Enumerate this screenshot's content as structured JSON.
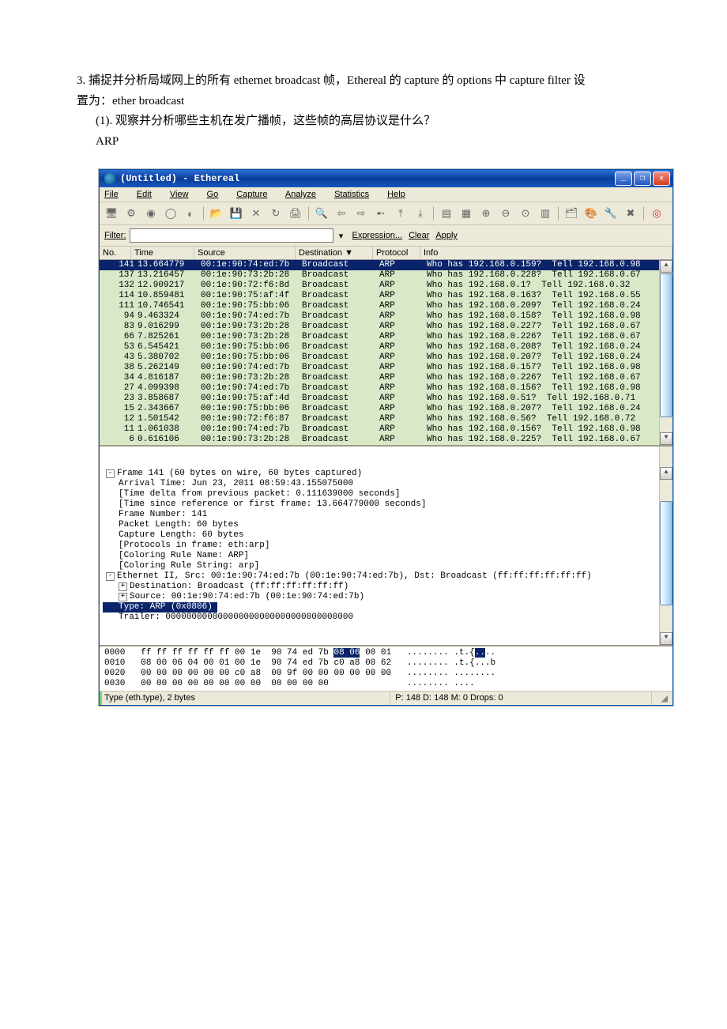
{
  "question": {
    "line1": "3. 捕捉并分析局域网上的所有 ethernet broadcast 帧，Ethereal 的 capture  的 options 中 capture filter 设",
    "line2": "置为：ether broadcast",
    "sub": "(1). 观察并分析哪些主机在发广播帧，这些帧的高层协议是什么？",
    "ans": "ARP"
  },
  "window": {
    "title": "(Untitled) - Ethereal"
  },
  "menu": {
    "file": "File",
    "edit": "Edit",
    "view": "View",
    "go": "Go",
    "capture": "Capture",
    "analyze": "Analyze",
    "statistics": "Statistics",
    "help": "Help"
  },
  "filter": {
    "label": "Filter:",
    "value": "",
    "expr": "Expression...",
    "clear": "Clear",
    "apply": "Apply",
    "dd": "▾"
  },
  "columns": {
    "no": "No. ",
    "time": "Time",
    "src": "Source",
    "dst": "Destination ▼",
    "proto": "Protocol",
    "info": "Info"
  },
  "packets": [
    {
      "no": "141",
      "time": "13.664779",
      "src": "00:1e:90:74:ed:7b",
      "dst": "Broadcast",
      "proto": "ARP",
      "info": "Who has 192.168.0.159?  Tell 192.168.0.98",
      "sel": true
    },
    {
      "no": "137",
      "time": "13.216457",
      "src": "00:1e:90:73:2b:28",
      "dst": "Broadcast",
      "proto": "ARP",
      "info": "Who has 192.168.0.228?  Tell 192.168.0.67"
    },
    {
      "no": "132",
      "time": "12.909217",
      "src": "00:1e:90:72:f6:8d",
      "dst": "Broadcast",
      "proto": "ARP",
      "info": "Who has 192.168.0.1?  Tell 192.168.0.32"
    },
    {
      "no": "114",
      "time": "10.859481",
      "src": "00:1e:90:75:af:4f",
      "dst": "Broadcast",
      "proto": "ARP",
      "info": "Who has 192.168.0.163?  Tell 192.168.0.55"
    },
    {
      "no": "111",
      "time": "10.746541",
      "src": "00:1e:90:75:bb:06",
      "dst": "Broadcast",
      "proto": "ARP",
      "info": "Who has 192.168.0.209?  Tell 192.168.0.24"
    },
    {
      "no": "94",
      "time": "9.463324",
      "src": "00:1e:90:74:ed:7b",
      "dst": "Broadcast",
      "proto": "ARP",
      "info": "Who has 192.168.0.158?  Tell 192.168.0.98"
    },
    {
      "no": "83",
      "time": "9.016299",
      "src": "00:1e:90:73:2b:28",
      "dst": "Broadcast",
      "proto": "ARP",
      "info": "Who has 192.168.0.227?  Tell 192.168.0.67"
    },
    {
      "no": "66",
      "time": "7.825261",
      "src": "00:1e:90:73:2b:28",
      "dst": "Broadcast",
      "proto": "ARP",
      "info": "Who has 192.168.0.226?  Tell 192.168.0.67"
    },
    {
      "no": "53",
      "time": "6.545421",
      "src": "00:1e:90:75:bb:06",
      "dst": "Broadcast",
      "proto": "ARP",
      "info": "Who has 192.168.0.208?  Tell 192.168.0.24"
    },
    {
      "no": "43",
      "time": "5.380702",
      "src": "00:1e:90:75:bb:06",
      "dst": "Broadcast",
      "proto": "ARP",
      "info": "Who has 192.168.0.207?  Tell 192.168.0.24"
    },
    {
      "no": "38",
      "time": "5.262149",
      "src": "00:1e:90:74:ed:7b",
      "dst": "Broadcast",
      "proto": "ARP",
      "info": "Who has 192.168.0.157?  Tell 192.168.0.98"
    },
    {
      "no": "34",
      "time": "4.816187",
      "src": "00:1e:90:73:2b:28",
      "dst": "Broadcast",
      "proto": "ARP",
      "info": "Who has 192.168.0.226?  Tell 192.168.0.67"
    },
    {
      "no": "27",
      "time": "4.099398",
      "src": "00:1e:90:74:ed:7b",
      "dst": "Broadcast",
      "proto": "ARP",
      "info": "Who has 192.168.0.156?  Tell 192.168.0.98"
    },
    {
      "no": "23",
      "time": "3.858687",
      "src": "00:1e:90:75:af:4d",
      "dst": "Broadcast",
      "proto": "ARP",
      "info": "Who has 192.168.0.51?  Tell 192.168.0.71"
    },
    {
      "no": "15",
      "time": "2.343667",
      "src": "00:1e:90:75:bb:06",
      "dst": "Broadcast",
      "proto": "ARP",
      "info": "Who has 192.168.0.207?  Tell 192.168.0.24"
    },
    {
      "no": "12",
      "time": "1.501542",
      "src": "00:1e:90:72:f6:87",
      "dst": "Broadcast",
      "proto": "ARP",
      "info": "Who has 192.168.0.56?  Tell 192.168.0.72"
    },
    {
      "no": "11",
      "time": "1.061038",
      "src": "00:1e:90:74:ed:7b",
      "dst": "Broadcast",
      "proto": "ARP",
      "info": "Who has 192.168.0.156?  Tell 192.168.0.98"
    },
    {
      "no": "6",
      "time": "0.616106",
      "src": "00:1e:90:73:2b:28",
      "dst": "Broadcast",
      "proto": "ARP",
      "info": "Who has 192.168.0.225?  Tell 192.168.0.67"
    }
  ],
  "tree": [
    {
      "lvl": 0,
      "sym": "⊟",
      "txt": "Frame 141 (60 bytes on wire, 60 bytes captured)"
    },
    {
      "lvl": 1,
      "txt": "Arrival Time: Jun 23, 2011 08:59:43.155075000"
    },
    {
      "lvl": 1,
      "txt": "[Time delta from previous packet: 0.111639000 seconds]"
    },
    {
      "lvl": 1,
      "txt": "[Time since reference or first frame: 13.664779000 seconds]"
    },
    {
      "lvl": 1,
      "txt": "Frame Number: 141"
    },
    {
      "lvl": 1,
      "txt": "Packet Length: 60 bytes"
    },
    {
      "lvl": 1,
      "txt": "Capture Length: 60 bytes"
    },
    {
      "lvl": 1,
      "txt": "[Protocols in frame: eth:arp]"
    },
    {
      "lvl": 1,
      "txt": "[Coloring Rule Name: ARP]"
    },
    {
      "lvl": 1,
      "txt": "[Coloring Rule String: arp]"
    },
    {
      "lvl": 0,
      "sym": "⊟",
      "txt": "Ethernet II, Src: 00:1e:90:74:ed:7b (00:1e:90:74:ed:7b), Dst: Broadcast (ff:ff:ff:ff:ff:ff)"
    },
    {
      "lvl": 1,
      "sym": "⊞",
      "txt": "Destination: Broadcast (ff:ff:ff:ff:ff:ff)"
    },
    {
      "lvl": 1,
      "sym": "⊞",
      "txt": "Source: 00:1e:90:74:ed:7b (00:1e:90:74:ed:7b)"
    },
    {
      "lvl": 1,
      "sel": true,
      "txt": "Type: ARP (0x0806)"
    },
    {
      "lvl": 1,
      "txt": "Trailer: 000000000000000000000000000000000000"
    }
  ],
  "hex": {
    "l0_off": "0000",
    "l0_h1": "ff ff ff ff ff ff 00 1e",
    "l0_h2": "90 74 ed 7b ",
    "l0_hl": "08 06",
    "l0_h3": " 00 01",
    "l0_a": "   ........ .t.{",
    "l0_ahl": "..",
    "l0_a2": "..",
    "l1_off": "0010",
    "l1_h1": "08 00 06 04 00 01 00 1e",
    "l1_h2": "90 74 ed 7b c0 a8 00 62",
    "l1_a": "   ........ .t.{...b",
    "l2_off": "0020",
    "l2_h1": "00 00 00 00 00 00 c0 a8",
    "l2_h2": "00 9f 00 00 00 00 00 00",
    "l2_a": "   ........ ........",
    "l3_off": "0030",
    "l3_h1": "00 00 00 00 00 00 00 00",
    "l3_h2": "00 00 00 00            ",
    "l3_a": "   ........ ....    "
  },
  "status": {
    "left": "Type (eth.type), 2 bytes",
    "right": "P: 148 D: 148 M: 0 Drops: 0"
  }
}
